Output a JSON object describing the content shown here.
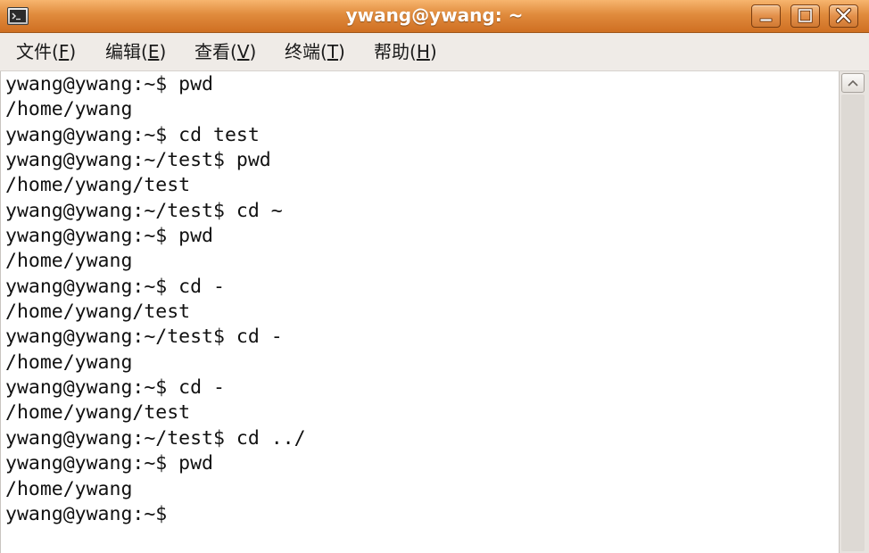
{
  "window": {
    "title": "ywang@ywang: ~"
  },
  "menubar": {
    "items": [
      {
        "label": "文件(",
        "mnemonic": "F",
        "close": ")"
      },
      {
        "label": "编辑(",
        "mnemonic": "E",
        "close": ")"
      },
      {
        "label": "查看(",
        "mnemonic": "V",
        "close": ")"
      },
      {
        "label": "终端(",
        "mnemonic": "T",
        "close": ")"
      },
      {
        "label": "帮助(",
        "mnemonic": "H",
        "close": ")"
      }
    ]
  },
  "terminal": {
    "lines": [
      "ywang@ywang:~$ pwd",
      "/home/ywang",
      "ywang@ywang:~$ cd test",
      "ywang@ywang:~/test$ pwd",
      "/home/ywang/test",
      "ywang@ywang:~/test$ cd ~",
      "ywang@ywang:~$ pwd",
      "/home/ywang",
      "ywang@ywang:~$ cd -",
      "/home/ywang/test",
      "ywang@ywang:~/test$ cd -",
      "/home/ywang",
      "ywang@ywang:~$ cd -",
      "/home/ywang/test",
      "ywang@ywang:~/test$ cd ../",
      "ywang@ywang:~$ pwd",
      "/home/ywang",
      "ywang@ywang:~$"
    ]
  },
  "icons": {
    "window_icon": "terminal-icon",
    "minimize": "minimize-icon",
    "maximize": "maximize-icon",
    "close": "close-icon",
    "scroll_up": "arrow-up-icon"
  },
  "colors": {
    "titlebar": "#e08b3d",
    "menubar_bg": "#efebe7",
    "terminal_bg": "#ffffff",
    "text": "#111111"
  }
}
